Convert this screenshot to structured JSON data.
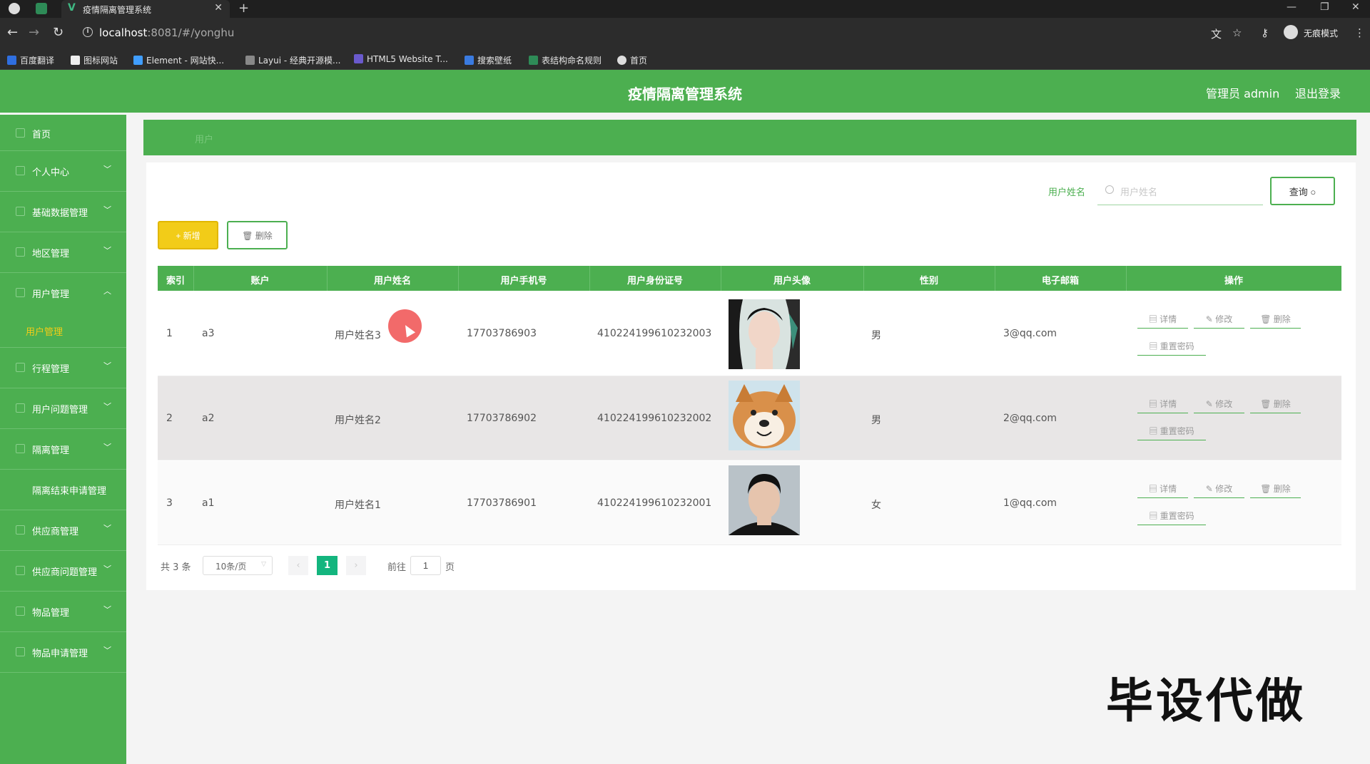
{
  "browser": {
    "tab_title": "疫情隔离管理系统",
    "url_host": "localhost",
    "url_rest": ":8081/#/yonghu",
    "incognito_label": "无痕模式",
    "bookmarks": [
      "百度翻译",
      "图标网站",
      "Element - 网站快...",
      "Layui - 经典开源模...",
      "HTML5 Website T...",
      "搜索壁纸",
      "表结构命名规则",
      "首页"
    ]
  },
  "header": {
    "title": "疫情隔离管理系统",
    "user": "管理员 admin",
    "logout": "退出登录"
  },
  "sidebar": {
    "items": [
      {
        "label": "首页",
        "chevron": ""
      },
      {
        "label": "个人中心",
        "chevron": "﹀"
      },
      {
        "label": "基础数据管理",
        "chevron": "﹀"
      },
      {
        "label": "地区管理",
        "chevron": "﹀"
      },
      {
        "label": "用户管理",
        "chevron": "︿"
      },
      {
        "label": "用户管理",
        "chevron": ""
      },
      {
        "label": "行程管理",
        "chevron": "﹀"
      },
      {
        "label": "用户问题管理",
        "chevron": "﹀"
      },
      {
        "label": "隔离管理",
        "chevron": "﹀"
      },
      {
        "label": "隔离结束申请管理",
        "chevron": ""
      },
      {
        "label": "供应商管理",
        "chevron": "﹀"
      },
      {
        "label": "供应商问题管理",
        "chevron": "﹀"
      },
      {
        "label": "物品管理",
        "chevron": "﹀"
      },
      {
        "label": "物品申请管理",
        "chevron": "﹀"
      }
    ]
  },
  "breadcrumb": "用户",
  "search": {
    "label": "用户姓名",
    "placeholder": "用户姓名",
    "button": "查询"
  },
  "toolbar": {
    "add": "+ 新增",
    "delete": "删除"
  },
  "table": {
    "columns": [
      "索引",
      "账户",
      "用户姓名",
      "用户手机号",
      "用户身份证号",
      "用户头像",
      "性别",
      "电子邮箱",
      "操作"
    ],
    "rows": [
      {
        "index": "1",
        "account": "a3",
        "name": "用户姓名3",
        "phone": "17703786903",
        "idcard": "410224199610232003",
        "gender": "男",
        "email": "3@qq.com"
      },
      {
        "index": "2",
        "account": "a2",
        "name": "用户姓名2",
        "phone": "17703786902",
        "idcard": "410224199610232002",
        "gender": "男",
        "email": "2@qq.com"
      },
      {
        "index": "3",
        "account": "a1",
        "name": "用户姓名1",
        "phone": "17703786901",
        "idcard": "410224199610232001",
        "gender": "女",
        "email": "1@qq.com"
      }
    ],
    "actions": {
      "detail": "详情",
      "edit": "修改",
      "delete": "删除",
      "reset": "重置密码"
    }
  },
  "pagination": {
    "total": "共 3 条",
    "page_size": "10条/页",
    "current": "1",
    "goto_label": "前往",
    "goto_value": "1",
    "unit": "页"
  },
  "watermark": "毕设代做",
  "colors": {
    "primary": "#4caf50",
    "accent_yellow": "#f2cc18",
    "page_active": "#13b57e"
  }
}
